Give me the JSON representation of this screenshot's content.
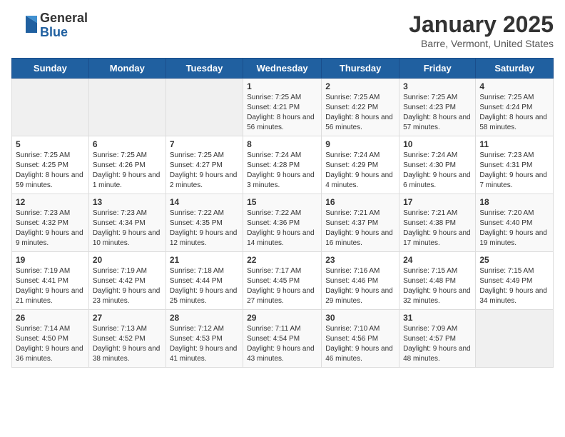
{
  "header": {
    "logo_general": "General",
    "logo_blue": "Blue",
    "month_title": "January 2025",
    "location": "Barre, Vermont, United States"
  },
  "days_of_week": [
    "Sunday",
    "Monday",
    "Tuesday",
    "Wednesday",
    "Thursday",
    "Friday",
    "Saturday"
  ],
  "weeks": [
    [
      {
        "num": "",
        "detail": ""
      },
      {
        "num": "",
        "detail": ""
      },
      {
        "num": "",
        "detail": ""
      },
      {
        "num": "1",
        "detail": "Sunrise: 7:25 AM\nSunset: 4:21 PM\nDaylight: 8 hours and 56 minutes."
      },
      {
        "num": "2",
        "detail": "Sunrise: 7:25 AM\nSunset: 4:22 PM\nDaylight: 8 hours and 56 minutes."
      },
      {
        "num": "3",
        "detail": "Sunrise: 7:25 AM\nSunset: 4:23 PM\nDaylight: 8 hours and 57 minutes."
      },
      {
        "num": "4",
        "detail": "Sunrise: 7:25 AM\nSunset: 4:24 PM\nDaylight: 8 hours and 58 minutes."
      }
    ],
    [
      {
        "num": "5",
        "detail": "Sunrise: 7:25 AM\nSunset: 4:25 PM\nDaylight: 8 hours and 59 minutes."
      },
      {
        "num": "6",
        "detail": "Sunrise: 7:25 AM\nSunset: 4:26 PM\nDaylight: 9 hours and 1 minute."
      },
      {
        "num": "7",
        "detail": "Sunrise: 7:25 AM\nSunset: 4:27 PM\nDaylight: 9 hours and 2 minutes."
      },
      {
        "num": "8",
        "detail": "Sunrise: 7:24 AM\nSunset: 4:28 PM\nDaylight: 9 hours and 3 minutes."
      },
      {
        "num": "9",
        "detail": "Sunrise: 7:24 AM\nSunset: 4:29 PM\nDaylight: 9 hours and 4 minutes."
      },
      {
        "num": "10",
        "detail": "Sunrise: 7:24 AM\nSunset: 4:30 PM\nDaylight: 9 hours and 6 minutes."
      },
      {
        "num": "11",
        "detail": "Sunrise: 7:23 AM\nSunset: 4:31 PM\nDaylight: 9 hours and 7 minutes."
      }
    ],
    [
      {
        "num": "12",
        "detail": "Sunrise: 7:23 AM\nSunset: 4:32 PM\nDaylight: 9 hours and 9 minutes."
      },
      {
        "num": "13",
        "detail": "Sunrise: 7:23 AM\nSunset: 4:34 PM\nDaylight: 9 hours and 10 minutes."
      },
      {
        "num": "14",
        "detail": "Sunrise: 7:22 AM\nSunset: 4:35 PM\nDaylight: 9 hours and 12 minutes."
      },
      {
        "num": "15",
        "detail": "Sunrise: 7:22 AM\nSunset: 4:36 PM\nDaylight: 9 hours and 14 minutes."
      },
      {
        "num": "16",
        "detail": "Sunrise: 7:21 AM\nSunset: 4:37 PM\nDaylight: 9 hours and 16 minutes."
      },
      {
        "num": "17",
        "detail": "Sunrise: 7:21 AM\nSunset: 4:38 PM\nDaylight: 9 hours and 17 minutes."
      },
      {
        "num": "18",
        "detail": "Sunrise: 7:20 AM\nSunset: 4:40 PM\nDaylight: 9 hours and 19 minutes."
      }
    ],
    [
      {
        "num": "19",
        "detail": "Sunrise: 7:19 AM\nSunset: 4:41 PM\nDaylight: 9 hours and 21 minutes."
      },
      {
        "num": "20",
        "detail": "Sunrise: 7:19 AM\nSunset: 4:42 PM\nDaylight: 9 hours and 23 minutes."
      },
      {
        "num": "21",
        "detail": "Sunrise: 7:18 AM\nSunset: 4:44 PM\nDaylight: 9 hours and 25 minutes."
      },
      {
        "num": "22",
        "detail": "Sunrise: 7:17 AM\nSunset: 4:45 PM\nDaylight: 9 hours and 27 minutes."
      },
      {
        "num": "23",
        "detail": "Sunrise: 7:16 AM\nSunset: 4:46 PM\nDaylight: 9 hours and 29 minutes."
      },
      {
        "num": "24",
        "detail": "Sunrise: 7:15 AM\nSunset: 4:48 PM\nDaylight: 9 hours and 32 minutes."
      },
      {
        "num": "25",
        "detail": "Sunrise: 7:15 AM\nSunset: 4:49 PM\nDaylight: 9 hours and 34 minutes."
      }
    ],
    [
      {
        "num": "26",
        "detail": "Sunrise: 7:14 AM\nSunset: 4:50 PM\nDaylight: 9 hours and 36 minutes."
      },
      {
        "num": "27",
        "detail": "Sunrise: 7:13 AM\nSunset: 4:52 PM\nDaylight: 9 hours and 38 minutes."
      },
      {
        "num": "28",
        "detail": "Sunrise: 7:12 AM\nSunset: 4:53 PM\nDaylight: 9 hours and 41 minutes."
      },
      {
        "num": "29",
        "detail": "Sunrise: 7:11 AM\nSunset: 4:54 PM\nDaylight: 9 hours and 43 minutes."
      },
      {
        "num": "30",
        "detail": "Sunrise: 7:10 AM\nSunset: 4:56 PM\nDaylight: 9 hours and 46 minutes."
      },
      {
        "num": "31",
        "detail": "Sunrise: 7:09 AM\nSunset: 4:57 PM\nDaylight: 9 hours and 48 minutes."
      },
      {
        "num": "",
        "detail": ""
      }
    ]
  ]
}
